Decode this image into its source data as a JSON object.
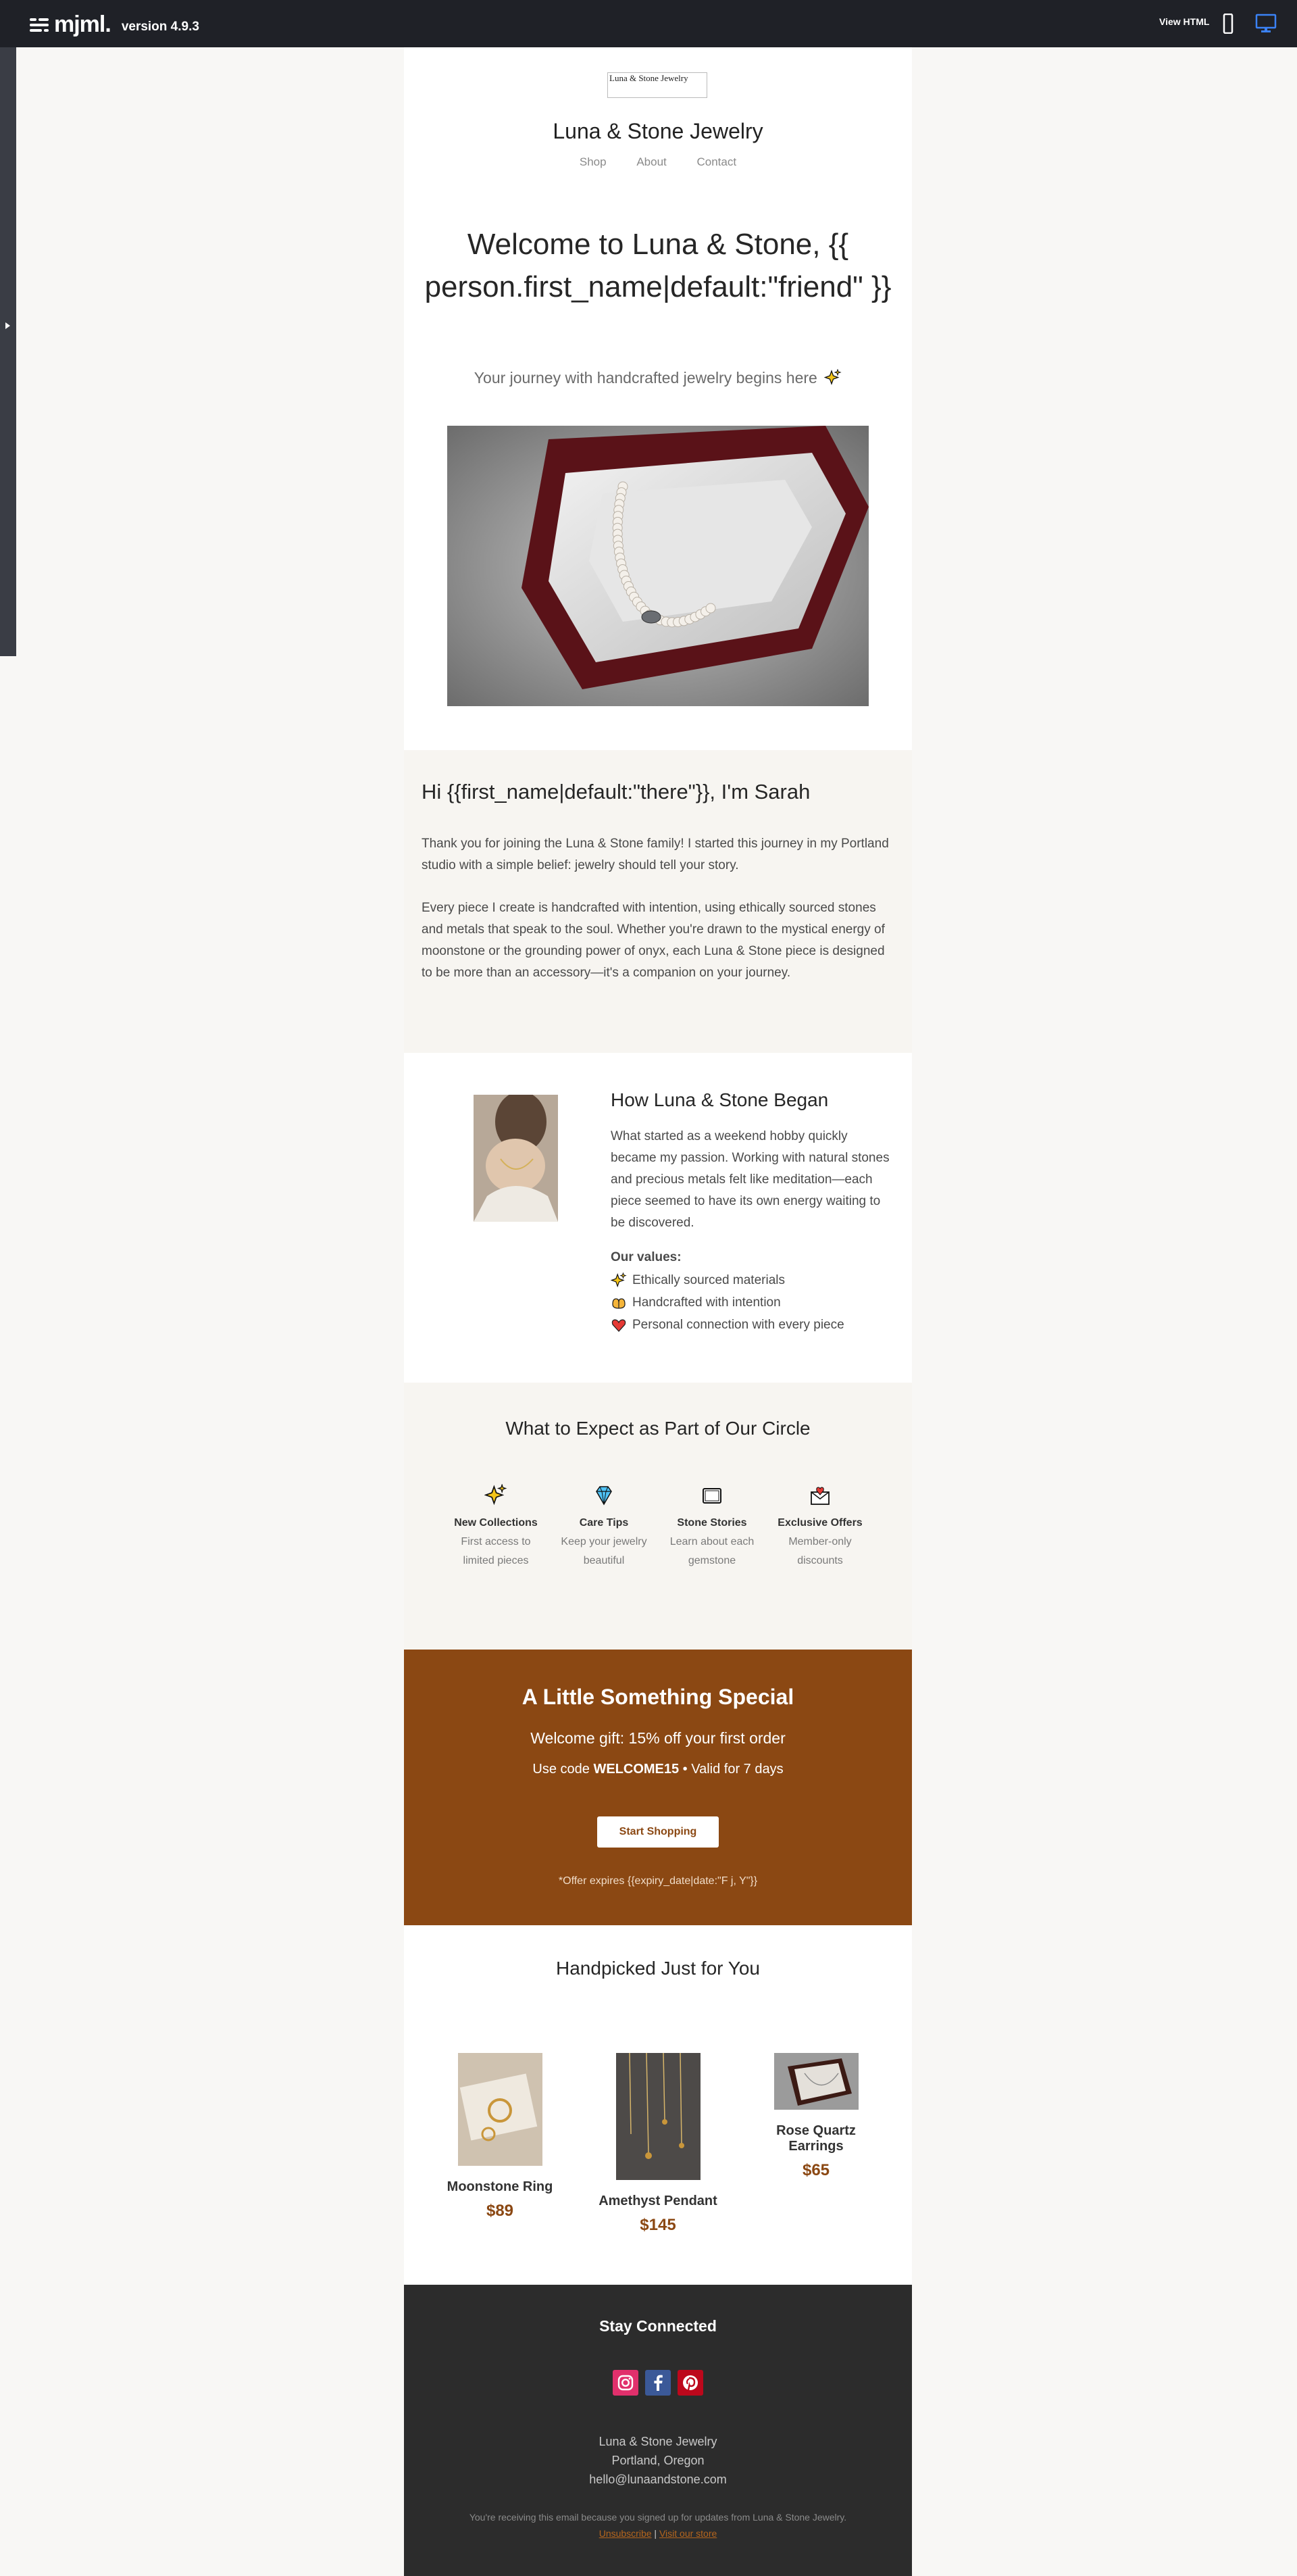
{
  "app": {
    "logo_text": "mjml.",
    "version": "version 4.9.3",
    "view_html": "View HTML"
  },
  "header": {
    "logo_alt": "Luna & Stone Jewelry",
    "brand": "Luna & Stone Jewelry",
    "nav": [
      "Shop",
      "About",
      "Contact"
    ],
    "welcome": "Welcome to Luna & Stone, {{ person.first_name|default:\"friend\" }}",
    "tagline": "Your journey with handcrafted jewelry begins here"
  },
  "intro": {
    "heading": "Hi {{first_name|default:\"there\"}}, I'm Sarah",
    "p1": "Thank you for joining the Luna & Stone family! I started this journey in my Portland studio with a simple belief: jewelry should tell your story.",
    "p2": "Every piece I create is handcrafted with intention, using ethically sourced stones and metals that speak to the soul. Whether you're drawn to the mystical energy of moonstone or the grounding power of onyx, each Luna & Stone piece is designed to be more than an accessory—it's a companion on your journey."
  },
  "story": {
    "heading": "How Luna & Stone Began",
    "body": "What started as a weekend hobby quickly became my passion. Working with natural stones and precious metals felt like meditation—each piece seemed to have its own energy waiting to be discovered.",
    "values_title": "Our values:",
    "values": [
      "Ethically sourced materials",
      "Handcrafted with intention",
      "Personal connection with every piece"
    ]
  },
  "circle": {
    "heading": "What to Expect as Part of Our Circle",
    "perks": [
      {
        "title": "New Collections",
        "desc": "First access to limited pieces",
        "icon": "sparkles-icon"
      },
      {
        "title": "Care Tips",
        "desc": "Keep your jewelry beautiful",
        "icon": "gem-icon"
      },
      {
        "title": "Stone Stories",
        "desc": "Learn about each gemstone",
        "icon": "book-icon"
      },
      {
        "title": "Exclusive Offers",
        "desc": "Member-only discounts",
        "icon": "envelope-heart-icon"
      }
    ]
  },
  "promo": {
    "heading": "A Little Something Special",
    "gift": "Welcome gift: 15% off your first order",
    "code_prefix": "Use code ",
    "code": "WELCOME15",
    "code_suffix": " • Valid for 7 days",
    "button": "Start Shopping",
    "fine": "*Offer expires {{expiry_date|date:\"F j, Y\"}}"
  },
  "picks": {
    "heading": "Handpicked Just for You",
    "products": [
      {
        "name": "Moonstone Ring",
        "price": "$89"
      },
      {
        "name": "Amethyst Pendant",
        "price": "$145"
      },
      {
        "name": "Rose Quartz Earrings",
        "price": "$65"
      }
    ]
  },
  "footer": {
    "heading": "Stay Connected",
    "company": "Luna & Stone Jewelry",
    "city": "Portland, Oregon",
    "email": "hello@lunaandstone.com",
    "notice": "You're receiving this email because you signed up for updates from Luna & Stone Jewelry.",
    "unsubscribe": "Unsubscribe",
    "separator": "|",
    "visit": "Visit our store"
  },
  "colors": {
    "topbar": "#1f2127",
    "accent": "#8b4813",
    "cream": "#f7f5f1",
    "footer": "#2c2c2c",
    "desktop_active": "#3b82f6"
  }
}
